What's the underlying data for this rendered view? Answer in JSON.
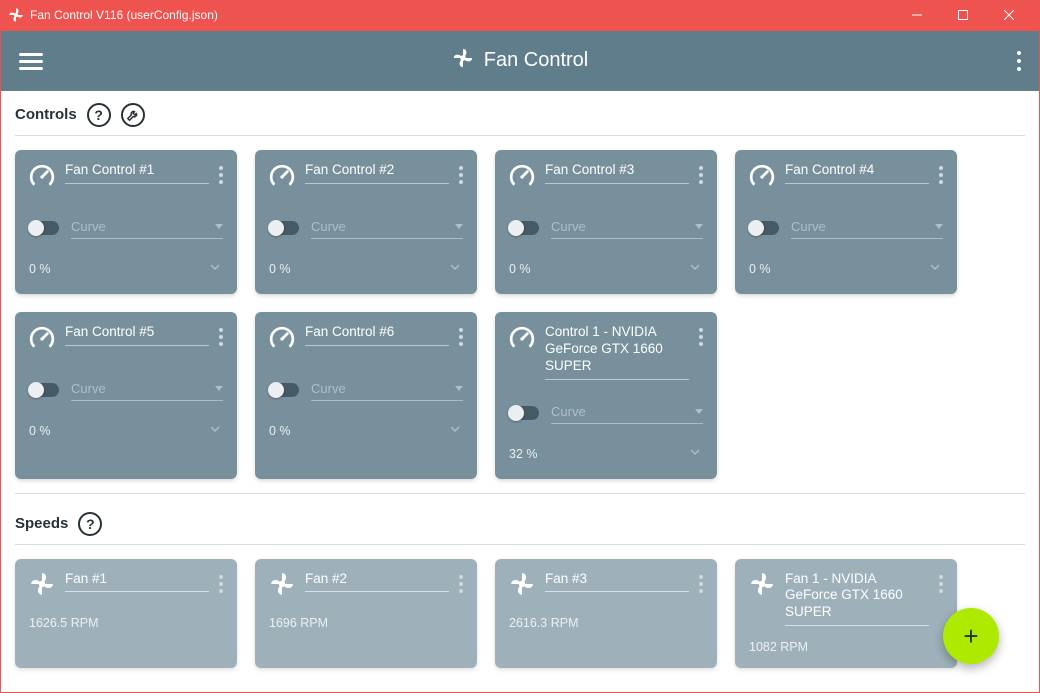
{
  "window": {
    "title": "Fan Control V116 (userConfig.json)"
  },
  "header": {
    "title": "Fan Control"
  },
  "sections": {
    "controls_label": "Controls",
    "speeds_label": "Speeds"
  },
  "controls": [
    {
      "name": "Fan Control #1",
      "curve_placeholder": "Curve",
      "pct": "0 %"
    },
    {
      "name": "Fan Control #2",
      "curve_placeholder": "Curve",
      "pct": "0 %"
    },
    {
      "name": "Fan Control #3",
      "curve_placeholder": "Curve",
      "pct": "0 %"
    },
    {
      "name": "Fan Control #4",
      "curve_placeholder": "Curve",
      "pct": "0 %"
    },
    {
      "name": "Fan Control #5",
      "curve_placeholder": "Curve",
      "pct": "0 %"
    },
    {
      "name": "Fan Control #6",
      "curve_placeholder": "Curve",
      "pct": "0 %"
    },
    {
      "name": "Control 1 - NVIDIA GeForce GTX 1660 SUPER",
      "curve_placeholder": "Curve",
      "pct": "32 %"
    }
  ],
  "speeds": [
    {
      "name": "Fan #1",
      "rpm": "1626.5 RPM"
    },
    {
      "name": "Fan #2",
      "rpm": "1696 RPM"
    },
    {
      "name": "Fan #3",
      "rpm": "2616.3 RPM"
    },
    {
      "name": "Fan 1 - NVIDIA GeForce GTX 1660 SUPER",
      "rpm": "1082 RPM"
    }
  ],
  "fab": {
    "label": "+"
  }
}
